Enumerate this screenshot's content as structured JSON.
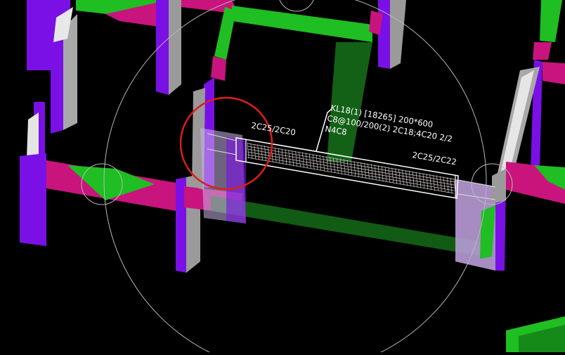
{
  "viewport": {
    "background": "#000000",
    "colors": {
      "column": "#7a10e6",
      "column_shade": "#9a9a9a",
      "beam_green": "#1fbe22",
      "beam_magenta": "#c8147c",
      "selected_outline": "#ffffff",
      "rebar": "#c9c2bd",
      "highlight_circle": "#e01c1c",
      "guide_circle": "#b9b9b9"
    }
  },
  "beam_annotation": {
    "line1": "KL18(1) [18265] 200*600",
    "line2": "C8@100/200(2) 2C18;4C20 2/2",
    "line3": "N4C8"
  },
  "support_labels": {
    "left": "2C25/2C20",
    "right": "2C25/2C22"
  }
}
